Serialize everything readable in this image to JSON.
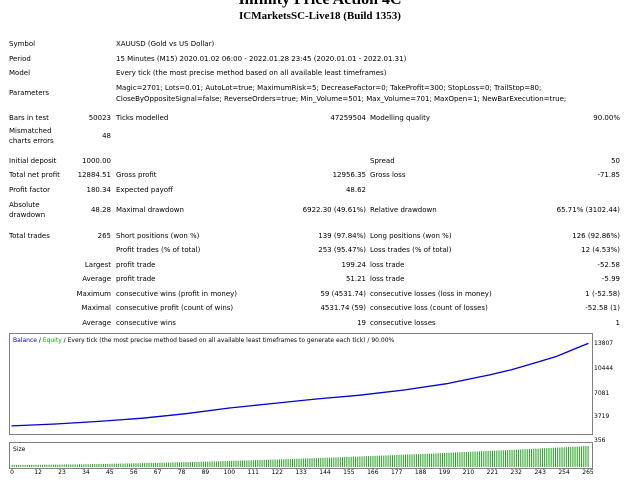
{
  "title": "Infinity Price Action 4C",
  "subtitle": "ICMarketsSC-Live18 (Build 1353)",
  "rows": {
    "symbol": {
      "label": "Symbol",
      "value": "XAUUSD (Gold vs US Dollar)"
    },
    "period": {
      "label": "Period",
      "value": "15 Minutes (M15) 2020.01.02 06:00 - 2022.01.28 23:45 (2020.01.01 - 2022.01.31)"
    },
    "model": {
      "label": "Model",
      "value": "Every tick (the most precise method based on all available least timeframes)"
    },
    "parameters": {
      "label": "Parameters",
      "line1": "Magic=2701; Lots=0.01; AutoLot=true; MaximumRisk=5; DecreaseFactor=0; TakeProfit=300; StopLoss=0; TrailStop=80;",
      "line2": "CloseByOppositeSignal=false; ReverseOrders=true; Min_Volume=501; Max_Volume=701; MaxOpen=1; NewBarExecution=true;"
    }
  },
  "stats": {
    "bars_label": "Bars in test",
    "bars_value": "50023",
    "ticks_label": "Ticks modelled",
    "ticks_value": "47259504",
    "quality_label": "Modelling quality",
    "quality_value": "90.00%",
    "mismatched_label_1": "Mismatched",
    "mismatched_label_2": "charts errors",
    "mismatched_value": "48",
    "initial_label": "Initial deposit",
    "initial_value": "1000.00",
    "spread_label": "Spread",
    "spread_value": "50",
    "net_label": "Total net profit",
    "net_value": "12884.51",
    "gross_profit_label": "Gross profit",
    "gross_profit_value": "12956.35",
    "gross_loss_label": "Gross loss",
    "gross_loss_value": "-71.85",
    "pf_label": "Profit factor",
    "pf_value": "180.34",
    "ep_label": "Expected payoff",
    "ep_value": "48.62",
    "abs_label_1": "Absolute",
    "abs_label_2": "drawdown",
    "abs_value": "48.28",
    "max_dd_label": "Maximal drawdown",
    "max_dd_value": "6922.30 (49.61%)",
    "rel_dd_label": "Relative drawdown",
    "rel_dd_value": "65.71% (3102.44)",
    "tt_label": "Total trades",
    "tt_value": "265",
    "short_label": "Short positions (won %)",
    "short_value": "139 (97.84%)",
    "long_label": "Long positions (won %)",
    "long_value": "126 (92.86%)",
    "pt_label": "Profit trades (% of total)",
    "pt_value": "253 (95.47%)",
    "lt_label": "Loss trades (% of total)",
    "lt_value": "12 (4.53%)",
    "largest": "Largest",
    "lp_label": "profit trade",
    "lp_value": "199.24",
    "ll_label": "loss trade",
    "ll_value": "-52.58",
    "average": "Average",
    "ap_label": "profit trade",
    "ap_value": "51.21",
    "al_label": "loss trade",
    "al_value": "-5.99",
    "maximum": "Maximum",
    "mcw_label": "consecutive wins (profit in money)",
    "mcw_value": "59 (4531.74)",
    "mcl_label": "consecutive losses (loss in money)",
    "mcl_value": "1 (-52.58)",
    "maximal": "Maximal",
    "mcp_label": "consecutive profit (count of wins)",
    "mcp_value": "4531.74 (59)",
    "mclc_label": "consecutive loss (count of losses)",
    "mclc_value": "-52.58 (1)",
    "average2": "Average",
    "acw_label": "consecutive wins",
    "acw_value": "19",
    "acl_label": "consecutive losses",
    "acl_value": "1"
  },
  "chart_data": {
    "type": "line",
    "legend_balance": "Balance",
    "legend_sep1": " / ",
    "legend_equity": "Equity",
    "legend_rest": " / Every tick (the most precise method based on all available least timeframes to generate each tick) / 90.00%",
    "size_label": "Size",
    "y_ticks": [
      "13807",
      "10444",
      "7081",
      "3719",
      "356"
    ],
    "x_ticks": [
      "0",
      "12",
      "23",
      "34",
      "45",
      "56",
      "67",
      "78",
      "89",
      "100",
      "111",
      "122",
      "133",
      "144",
      "155",
      "166",
      "177",
      "188",
      "199",
      "210",
      "221",
      "232",
      "243",
      "254",
      "265"
    ],
    "series": [
      {
        "name": "Balance",
        "color": "#0000cc",
        "x": [
          0,
          20,
          40,
          60,
          80,
          100,
          120,
          140,
          160,
          180,
          200,
          220,
          230,
          240,
          250,
          255,
          260,
          265
        ],
        "y": [
          1000,
          1300,
          1700,
          2200,
          2900,
          3800,
          4500,
          5200,
          5800,
          6600,
          7600,
          9000,
          9800,
          10800,
          11800,
          12500,
          13200,
          13885
        ]
      }
    ],
    "size_color": "#20a020"
  }
}
